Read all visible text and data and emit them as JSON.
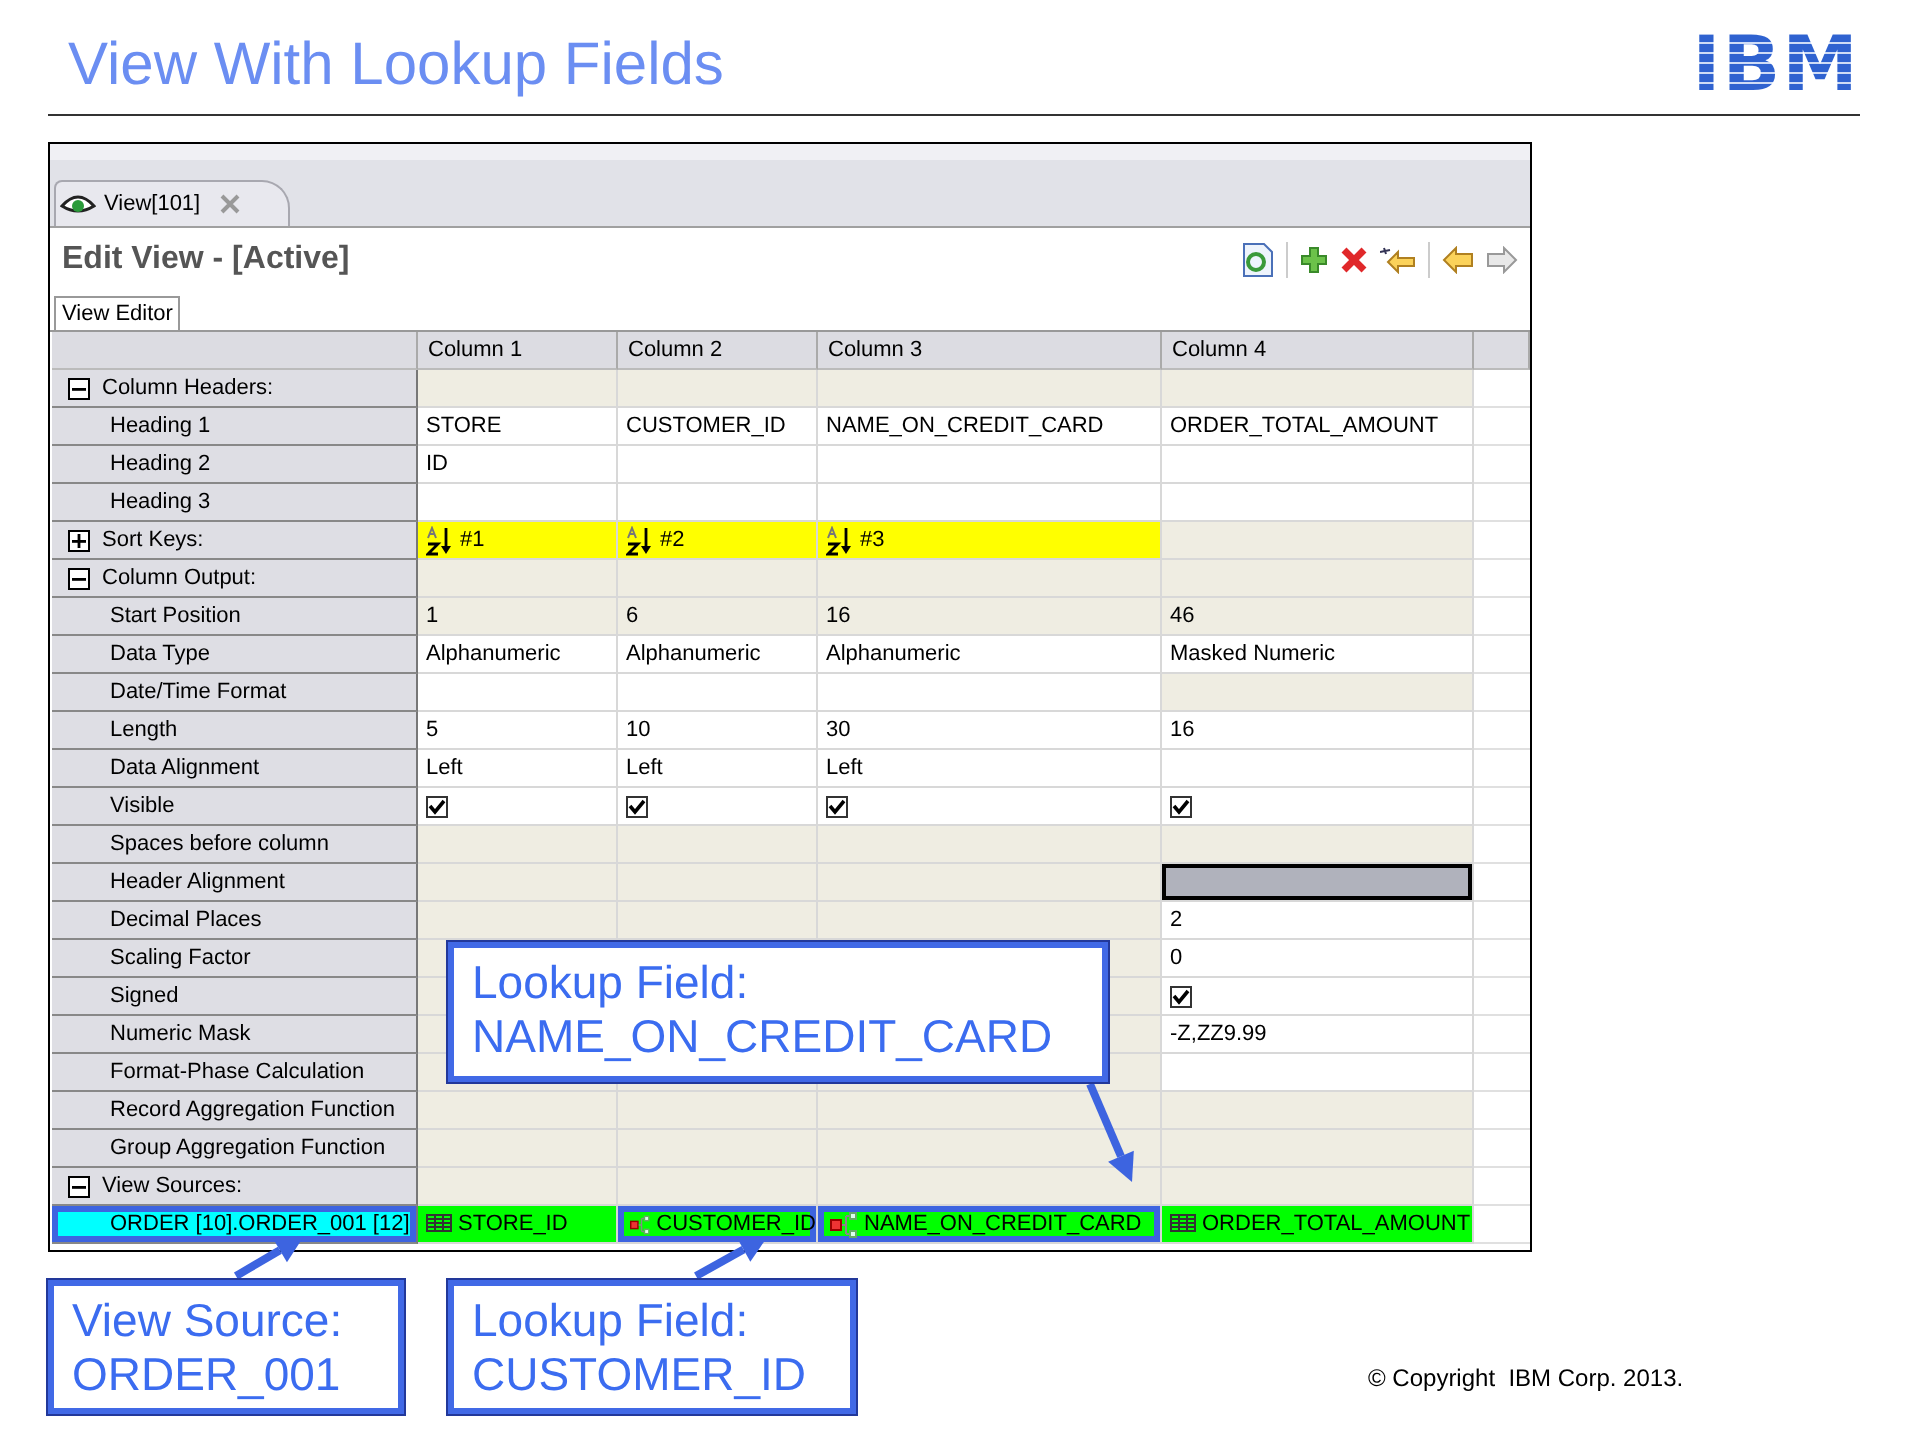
{
  "slide": {
    "title": "View With Lookup Fields",
    "logo": "IBM",
    "copyright": "© Copyright  IBM Corp. 2013."
  },
  "editor": {
    "tab": "View[101]",
    "heading": "Edit View - [Active]",
    "subtab": "View Editor",
    "columns": [
      "Column 1",
      "Column 2",
      "Column 3",
      "Column 4"
    ],
    "rows": [
      {
        "kind": "section",
        "label": "Column Headers:",
        "expanded": true,
        "cells": [
          {
            "kind": "text",
            "disabled": true,
            "selected": false
          },
          {
            "kind": "text",
            "disabled": true,
            "selected": false
          },
          {
            "kind": "text",
            "disabled": true,
            "selected": false
          },
          {
            "kind": "text",
            "disabled": true,
            "selected": false
          }
        ]
      },
      {
        "kind": "field",
        "label": "Heading 1",
        "cells": [
          {
            "kind": "text",
            "text": "STORE",
            "disabled": false,
            "selected": false
          },
          {
            "kind": "text",
            "text": "CUSTOMER_ID",
            "disabled": false,
            "selected": false
          },
          {
            "kind": "text",
            "text": "NAME_ON_CREDIT_CARD",
            "disabled": false,
            "selected": false
          },
          {
            "kind": "text",
            "text": "ORDER_TOTAL_AMOUNT",
            "disabled": false,
            "selected": false
          }
        ]
      },
      {
        "kind": "field",
        "label": "Heading 2",
        "cells": [
          {
            "kind": "text",
            "text": "ID",
            "disabled": false,
            "selected": false
          },
          {
            "kind": "text",
            "disabled": false,
            "selected": false
          },
          {
            "kind": "text",
            "disabled": false,
            "selected": false
          },
          {
            "kind": "text",
            "disabled": false,
            "selected": false
          }
        ]
      },
      {
        "kind": "field",
        "label": "Heading 3",
        "cells": [
          {
            "kind": "text",
            "disabled": false,
            "selected": false
          },
          {
            "kind": "text",
            "disabled": false,
            "selected": false
          },
          {
            "kind": "text",
            "disabled": false,
            "selected": false
          },
          {
            "kind": "text",
            "disabled": false,
            "selected": false
          }
        ]
      },
      {
        "kind": "section",
        "label": "Sort Keys:",
        "expanded": false,
        "cells": [
          {
            "kind": "sort",
            "text": "#1",
            "selected": false
          },
          {
            "kind": "sort",
            "text": "#2",
            "selected": false
          },
          {
            "kind": "sort",
            "text": "#3",
            "selected": false
          },
          {
            "kind": "text",
            "disabled": true,
            "selected": false
          }
        ]
      },
      {
        "kind": "section",
        "label": "Column Output:",
        "expanded": true,
        "cells": [
          {
            "kind": "text",
            "disabled": true,
            "selected": false
          },
          {
            "kind": "text",
            "disabled": true,
            "selected": false
          },
          {
            "kind": "text",
            "disabled": true,
            "selected": false
          },
          {
            "kind": "text",
            "disabled": true,
            "selected": false
          }
        ]
      },
      {
        "kind": "field",
        "label": "Start Position",
        "cells": [
          {
            "kind": "text",
            "text": "1",
            "disabled": true,
            "selected": false
          },
          {
            "kind": "text",
            "text": "6",
            "disabled": true,
            "selected": false
          },
          {
            "kind": "text",
            "text": "16",
            "disabled": true,
            "selected": false
          },
          {
            "kind": "text",
            "text": "46",
            "disabled": true,
            "selected": false
          }
        ]
      },
      {
        "kind": "field",
        "label": "Data Type",
        "cells": [
          {
            "kind": "text",
            "text": "Alphanumeric",
            "disabled": false,
            "selected": false
          },
          {
            "kind": "text",
            "text": "Alphanumeric",
            "disabled": false,
            "selected": false
          },
          {
            "kind": "text",
            "text": "Alphanumeric",
            "disabled": false,
            "selected": false
          },
          {
            "kind": "text",
            "text": "Masked Numeric",
            "disabled": false,
            "selected": false
          }
        ]
      },
      {
        "kind": "field",
        "label": "Date/Time Format",
        "cells": [
          {
            "kind": "text",
            "disabled": false,
            "selected": false
          },
          {
            "kind": "text",
            "disabled": false,
            "selected": false
          },
          {
            "kind": "text",
            "disabled": false,
            "selected": false
          },
          {
            "kind": "text",
            "disabled": true,
            "selected": false
          }
        ]
      },
      {
        "kind": "field",
        "label": "Length",
        "cells": [
          {
            "kind": "text",
            "text": "5",
            "disabled": false,
            "selected": false
          },
          {
            "kind": "text",
            "text": "10",
            "disabled": false,
            "selected": false
          },
          {
            "kind": "text",
            "text": "30",
            "disabled": false,
            "selected": false
          },
          {
            "kind": "text",
            "text": "16",
            "disabled": false,
            "selected": false
          }
        ]
      },
      {
        "kind": "field",
        "label": "Data Alignment",
        "cells": [
          {
            "kind": "text",
            "text": "Left",
            "disabled": false,
            "selected": false
          },
          {
            "kind": "text",
            "text": "Left",
            "disabled": false,
            "selected": false
          },
          {
            "kind": "text",
            "text": "Left",
            "disabled": false,
            "selected": false
          },
          {
            "kind": "text",
            "disabled": false,
            "selected": false
          }
        ]
      },
      {
        "kind": "field",
        "label": "Visible",
        "cells": [
          {
            "kind": "check",
            "checked": true,
            "disabled": false,
            "selected": false
          },
          {
            "kind": "check",
            "checked": true,
            "disabled": false,
            "selected": false
          },
          {
            "kind": "check",
            "checked": true,
            "disabled": false,
            "selected": false
          },
          {
            "kind": "check",
            "checked": true,
            "disabled": false,
            "selected": false
          }
        ]
      },
      {
        "kind": "field",
        "label": "Spaces before column",
        "cells": [
          {
            "kind": "text",
            "disabled": true,
            "selected": false
          },
          {
            "kind": "text",
            "disabled": true,
            "selected": false
          },
          {
            "kind": "text",
            "disabled": true,
            "selected": false
          },
          {
            "kind": "text",
            "disabled": true,
            "selected": false
          }
        ]
      },
      {
        "kind": "field",
        "label": "Header Alignment",
        "cells": [
          {
            "kind": "text",
            "disabled": true,
            "selected": false
          },
          {
            "kind": "text",
            "disabled": true,
            "selected": false
          },
          {
            "kind": "text",
            "disabled": true,
            "selected": false
          },
          {
            "kind": "text",
            "disabled": false,
            "selected": true
          }
        ]
      },
      {
        "kind": "field",
        "label": "Decimal Places",
        "cells": [
          {
            "kind": "text",
            "disabled": true,
            "selected": false
          },
          {
            "kind": "text",
            "disabled": true,
            "selected": false
          },
          {
            "kind": "text",
            "disabled": true,
            "selected": false
          },
          {
            "kind": "text",
            "text": "2",
            "disabled": false,
            "selected": false
          }
        ]
      },
      {
        "kind": "field",
        "label": "Scaling Factor",
        "cells": [
          {
            "kind": "text",
            "disabled": true,
            "selected": false
          },
          {
            "kind": "covered"
          },
          {
            "kind": "text",
            "disabled": true,
            "selected": false
          },
          {
            "kind": "text",
            "text": "0",
            "disabled": false,
            "selected": false
          }
        ]
      },
      {
        "kind": "field",
        "label": "Signed",
        "cells": [
          {
            "kind": "text",
            "disabled": true,
            "selected": false
          },
          {
            "kind": "covered"
          },
          {
            "kind": "text",
            "disabled": true,
            "selected": false
          },
          {
            "kind": "check",
            "checked": true,
            "disabled": false,
            "selected": false
          }
        ]
      },
      {
        "kind": "field",
        "label": "Numeric Mask",
        "cells": [
          {
            "kind": "text",
            "disabled": true,
            "selected": false
          },
          {
            "kind": "covered"
          },
          {
            "kind": "text",
            "disabled": true,
            "selected": false
          },
          {
            "kind": "text",
            "text": "-Z,ZZ9.99",
            "disabled": false,
            "selected": false
          }
        ]
      },
      {
        "kind": "field",
        "label": "Format-Phase Calculation",
        "cells": [
          {
            "kind": "text",
            "disabled": true,
            "selected": false
          },
          {
            "kind": "text",
            "disabled": true,
            "selected": false
          },
          {
            "kind": "text",
            "disabled": true,
            "selected": false
          },
          {
            "kind": "text",
            "disabled": false,
            "selected": false
          }
        ]
      },
      {
        "kind": "field",
        "label": "Record Aggregation Function",
        "cells": [
          {
            "kind": "text",
            "disabled": true,
            "selected": false
          },
          {
            "kind": "text",
            "disabled": true,
            "selected": false
          },
          {
            "kind": "text",
            "disabled": true,
            "selected": false
          },
          {
            "kind": "text",
            "disabled": true,
            "selected": false
          }
        ]
      },
      {
        "kind": "field",
        "label": "Group Aggregation Function",
        "cells": [
          {
            "kind": "text",
            "disabled": true,
            "selected": false
          },
          {
            "kind": "text",
            "disabled": true,
            "selected": false
          },
          {
            "kind": "text",
            "disabled": true,
            "selected": false
          },
          {
            "kind": "text",
            "disabled": true,
            "selected": false
          }
        ]
      },
      {
        "kind": "section",
        "label": "View Sources:",
        "expanded": true,
        "cells": [
          {
            "kind": "text",
            "disabled": true,
            "selected": false
          },
          {
            "kind": "text",
            "disabled": true,
            "selected": false
          },
          {
            "kind": "text",
            "disabled": true,
            "selected": false
          },
          {
            "kind": "text",
            "disabled": true,
            "selected": false
          }
        ]
      },
      {
        "kind": "source",
        "label": "ORDER [10].ORDER_001 [12]",
        "highlighted": true,
        "cells": [
          {
            "kind": "field",
            "text": "STORE_ID",
            "highlighted": false
          },
          {
            "kind": "lookup",
            "text": "CUSTOMER_ID",
            "highlighted": true
          },
          {
            "kind": "lookup",
            "text": "NAME_ON_CREDIT_CARD",
            "highlighted": true
          },
          {
            "kind": "field",
            "text": "ORDER_TOTAL_AMOUNT",
            "highlighted": false
          }
        ]
      }
    ]
  },
  "callouts": [
    {
      "text": "Lookup Field:\nNAME_ON_CREDIT_CARD"
    },
    {
      "text": "View Source:\nORDER_001"
    },
    {
      "text": "Lookup Field:\nCUSTOMER_ID"
    }
  ]
}
